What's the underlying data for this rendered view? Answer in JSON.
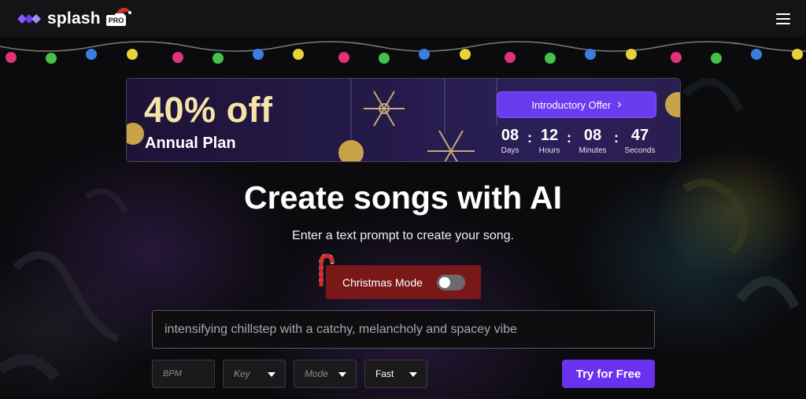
{
  "header": {
    "brand_name": "splash",
    "brand_badge": "PRO",
    "menu_icon": "hamburger-menu-icon"
  },
  "banner": {
    "discount": "40% off",
    "plan": "Annual Plan",
    "offer_button": "Introductory Offer",
    "countdown": {
      "days": "08",
      "days_label": "Days",
      "hours": "12",
      "hours_label": "Hours",
      "minutes": "08",
      "minutes_label": "Minutes",
      "seconds": "47",
      "seconds_label": "Seconds"
    }
  },
  "hero": {
    "title": "Create songs with AI",
    "subtitle": "Enter a text prompt to create your song."
  },
  "christmas_mode": {
    "label": "Christmas Mode",
    "enabled": false
  },
  "prompt": {
    "placeholder": "intensifying chillstep with a catchy, melancholy and spacey vibe"
  },
  "controls": {
    "bpm_placeholder": "BPM",
    "key_label": "Key",
    "mode_label": "Mode",
    "speed_value": "Fast",
    "try_button": "Try for Free"
  },
  "colors": {
    "accent": "#6a32ee",
    "banner_gold": "#f6e3a9",
    "christmas_red": "#7a1818",
    "header_bg": "#141316"
  }
}
